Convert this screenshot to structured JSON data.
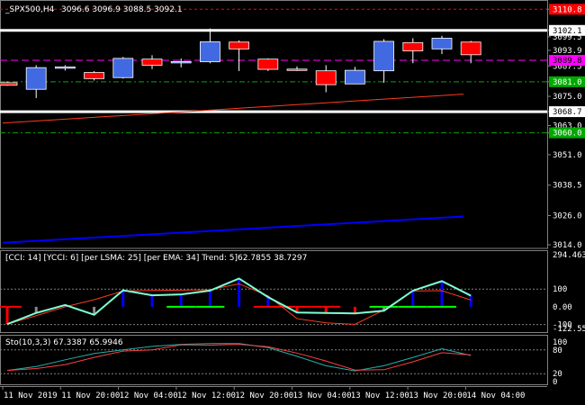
{
  "header": {
    "symbol": "_SPX500,H4",
    "ohlc": "3096.6 3096.9 3088.5 3092.1"
  },
  "colors": {
    "bull": "#4169e1",
    "bear": "#ff0000",
    "grid_green": "#00aa00",
    "magenta": "#ff00ff",
    "cci": "#7fffd4",
    "sto_main": "#ff4040",
    "sto_signal": "#20b2aa",
    "regression": "#0000ff"
  },
  "price_axis": {
    "ticks": [
      "3110.8",
      "3102.1",
      "3099.5",
      "3093.9",
      "3087.5",
      "3081.0",
      "3075.0",
      "3068.7",
      "3063.0",
      "3060.0",
      "3051.0",
      "3038.5",
      "3026.0",
      "3014.0"
    ],
    "tick_values": [
      3110.8,
      3102.1,
      3099.5,
      3093.9,
      3087.5,
      3081.0,
      3075.0,
      3068.7,
      3063.0,
      3060.0,
      3051.0,
      3038.5,
      3026.0,
      3014.0
    ],
    "highlights": [
      {
        "text": "3110.8",
        "bg": "#ff0000"
      },
      {
        "text": "3102.1",
        "bg": "#ffffff"
      },
      {
        "text": "3089.8",
        "bg": "#ff00ff"
      },
      {
        "text": "3081.0",
        "bg": "#00aa00"
      },
      {
        "text": "3068.7",
        "bg": "#ffffff"
      },
      {
        "text": "3060.0",
        "bg": "#00aa00"
      }
    ]
  },
  "cci_panel": {
    "title": "[CCI: 14] [YCCI: 6] [per LSMA: 25] [per EMA: 34] Trend: 5]",
    "values_text": "62.7855 38.7297",
    "axis": [
      "294.4631",
      "100",
      "0.00",
      "-100",
      "-122.5510"
    ]
  },
  "sto_panel": {
    "title": "Sto(10,3,3) 67.3387 65.9946",
    "axis": [
      "100",
      "80",
      "20",
      "0"
    ]
  },
  "time_axis": [
    "11 Nov 2019",
    "11 Nov 20:00",
    "12 Nov 04:00",
    "12 Nov 12:00",
    "12 Nov 20:00",
    "13 Nov 04:00",
    "13 Nov 12:00",
    "13 Nov 20:00",
    "14 Nov 04:00"
  ],
  "chart_data": {
    "type": "candlestick",
    "candles": [
      {
        "o": 3080.6,
        "h": 3081.2,
        "l": 3079.3,
        "c": 3079.6
      },
      {
        "o": 3077.9,
        "h": 3087.8,
        "l": 3074.3,
        "c": 3086.8
      },
      {
        "o": 3086.9,
        "h": 3087.8,
        "l": 3085.6,
        "c": 3087.1
      },
      {
        "o": 3084.8,
        "h": 3085.4,
        "l": 3081.5,
        "c": 3082.3
      },
      {
        "o": 3082.7,
        "h": 3091.2,
        "l": 3082.3,
        "c": 3090.6
      },
      {
        "o": 3090.3,
        "h": 3091.9,
        "l": 3086.2,
        "c": 3087.8
      },
      {
        "o": 3089.0,
        "h": 3090.6,
        "l": 3086.9,
        "c": 3089.3
      },
      {
        "o": 3089.2,
        "h": 3102.9,
        "l": 3088.6,
        "c": 3097.4
      },
      {
        "o": 3097.3,
        "h": 3098.0,
        "l": 3085.4,
        "c": 3094.5
      },
      {
        "o": 3090.3,
        "h": 3090.6,
        "l": 3085.4,
        "c": 3086.1
      },
      {
        "o": 3086.2,
        "h": 3087.3,
        "l": 3085.4,
        "c": 3085.8
      },
      {
        "o": 3085.5,
        "h": 3087.8,
        "l": 3076.7,
        "c": 3079.8
      },
      {
        "o": 3080.1,
        "h": 3087.1,
        "l": 3080.1,
        "c": 3085.7
      },
      {
        "o": 3085.5,
        "h": 3098.5,
        "l": 3080.6,
        "c": 3097.6
      },
      {
        "o": 3097.1,
        "h": 3098.9,
        "l": 3088.6,
        "c": 3093.7
      },
      {
        "o": 3094.5,
        "h": 3099.9,
        "l": 3092.4,
        "c": 3098.9
      },
      {
        "o": 3097.3,
        "h": 3097.8,
        "l": 3088.6,
        "c": 3092.1
      }
    ],
    "levels": {
      "red": 3110.8,
      "white_high": 3102.1,
      "magenta": 3089.8,
      "green_1": 3081.0,
      "white_low": 3068.7,
      "green_2": 3060.0
    },
    "cci": [
      -97.8,
      -34.8,
      10,
      -45,
      93.5,
      65,
      70,
      91.5,
      160,
      54.9,
      -32,
      -34.7,
      -37.4,
      -22,
      91.2,
      145,
      62.8
    ],
    "cci_signal": [
      -98,
      -50,
      0,
      40,
      89,
      92,
      94,
      96,
      130,
      62,
      -67,
      -91,
      -99,
      -18,
      89,
      91,
      38.7
    ],
    "sto_main": [
      28,
      33,
      43,
      61,
      77,
      80,
      93,
      92,
      94,
      88,
      72,
      52,
      29,
      30,
      50,
      73,
      67.3
    ],
    "sto_signal": [
      28,
      38,
      55,
      71,
      80,
      89,
      94,
      96,
      96,
      86,
      64,
      40,
      27,
      40,
      61,
      83,
      66.0
    ]
  }
}
